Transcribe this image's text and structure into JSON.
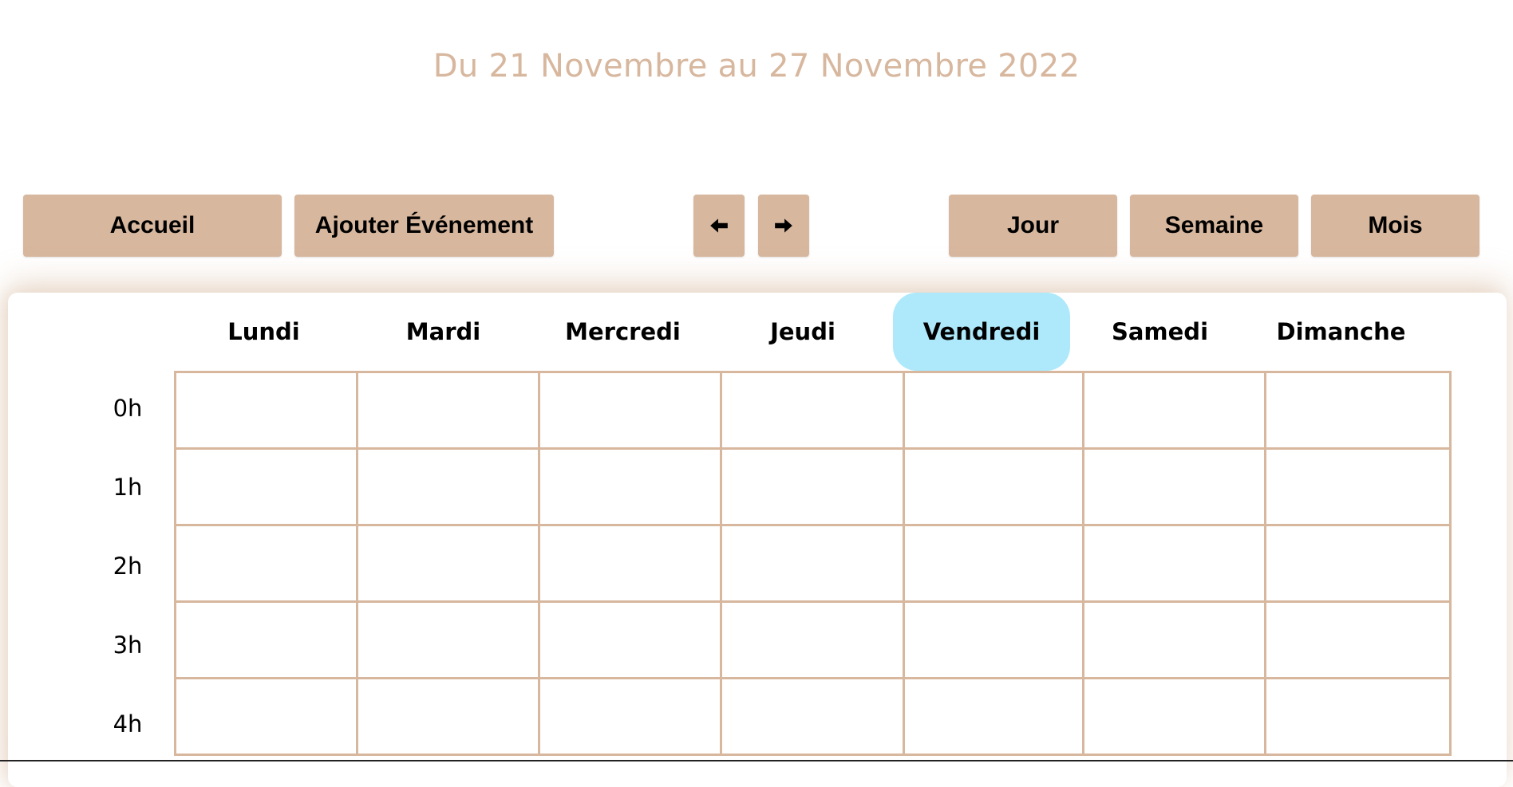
{
  "header": {
    "title": "Du 21 Novembre au 27 Novembre 2022"
  },
  "toolbar": {
    "home_label": "Accueil",
    "add_event_label": "Ajouter Événement",
    "prev_icon": "arrow-left-icon",
    "next_icon": "arrow-right-icon",
    "day_label": "Jour",
    "week_label": "Semaine",
    "month_label": "Mois"
  },
  "calendar": {
    "days": [
      {
        "label": "Lundi",
        "today": false
      },
      {
        "label": "Mardi",
        "today": false
      },
      {
        "label": "Mercredi",
        "today": false
      },
      {
        "label": "Jeudi",
        "today": false
      },
      {
        "label": "Vendredi",
        "today": true
      },
      {
        "label": "Samedi",
        "today": false
      },
      {
        "label": "Dimanche",
        "today": false
      }
    ],
    "hours": [
      "0h",
      "1h",
      "2h",
      "3h",
      "4h"
    ]
  },
  "colors": {
    "accent": "#d7b79e",
    "today_highlight": "#aee9fb"
  }
}
